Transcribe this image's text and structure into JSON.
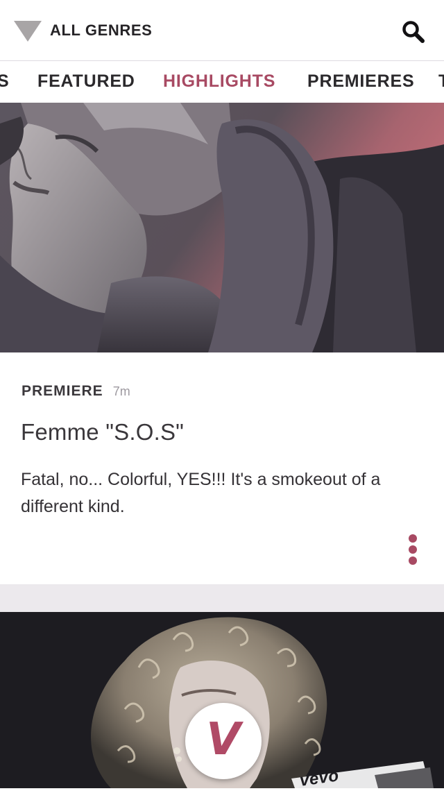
{
  "header": {
    "genre_label": "ALL GENRES",
    "genre_icon": "dropdown-triangle-icon",
    "search_icon": "search-icon"
  },
  "tabs": [
    {
      "label": "S",
      "active": false
    },
    {
      "label": "FEATURED",
      "active": false
    },
    {
      "label": "HIGHLIGHTS",
      "active": true
    },
    {
      "label": "PREMIERES",
      "active": false
    },
    {
      "label": "T",
      "active": false
    }
  ],
  "colors": {
    "accent": "#a84a63",
    "text_dark": "#2b292c",
    "separator": "#ece9ed",
    "triangle": "#a8a5a6"
  },
  "cards": [
    {
      "kind": "PREMIERE",
      "time": "7m",
      "title": "Femme \"S.O.S\"",
      "description": "Fatal, no... Colorful, YES!!!  It's a smokeout of a different kind.",
      "more_icon": "more-vertical-icon"
    },
    {
      "fab_icon": "vevo-logo-icon",
      "fab_letter": "V",
      "tag_text": "vevo"
    }
  ]
}
